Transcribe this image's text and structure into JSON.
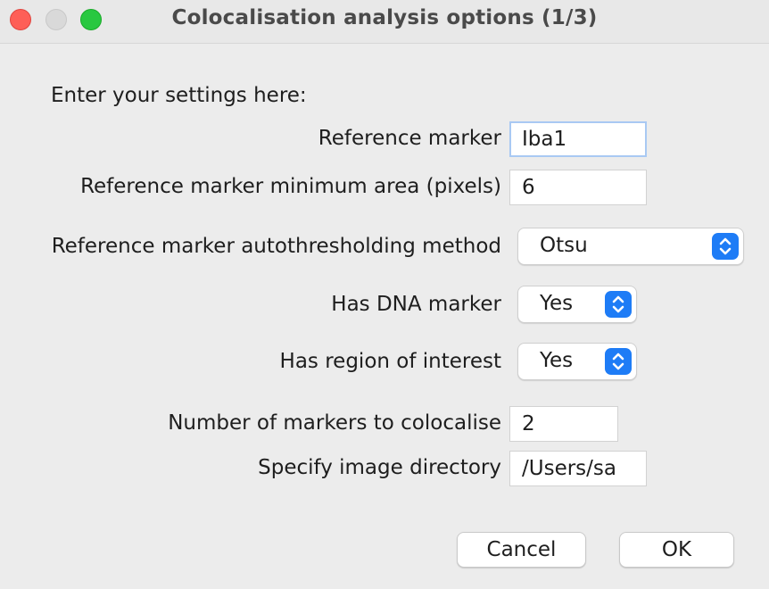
{
  "window": {
    "title": "Colocalisation analysis options (1/3)"
  },
  "form": {
    "intro": "Enter your settings here:",
    "reference_marker": {
      "label": "Reference marker",
      "value": "Iba1"
    },
    "min_area": {
      "label": "Reference marker minimum area (pixels)",
      "value": "6"
    },
    "autothreshold": {
      "label": "Reference marker autothresholding method",
      "selected": "Otsu"
    },
    "has_dna": {
      "label": "Has DNA marker",
      "selected": "Yes"
    },
    "has_roi": {
      "label": "Has region of interest",
      "selected": "Yes"
    },
    "num_markers": {
      "label": "Number of markers to colocalise",
      "value": "2"
    },
    "image_dir": {
      "label": "Specify image directory",
      "value": "/Users/sa"
    }
  },
  "buttons": {
    "cancel": "Cancel",
    "ok": "OK"
  },
  "colors": {
    "accent": "#1e7cf6",
    "close": "#fe5f57",
    "minimize_disabled": "#d9d9d9",
    "maximize": "#29c840",
    "focus_ring": "#a9c9f3"
  }
}
